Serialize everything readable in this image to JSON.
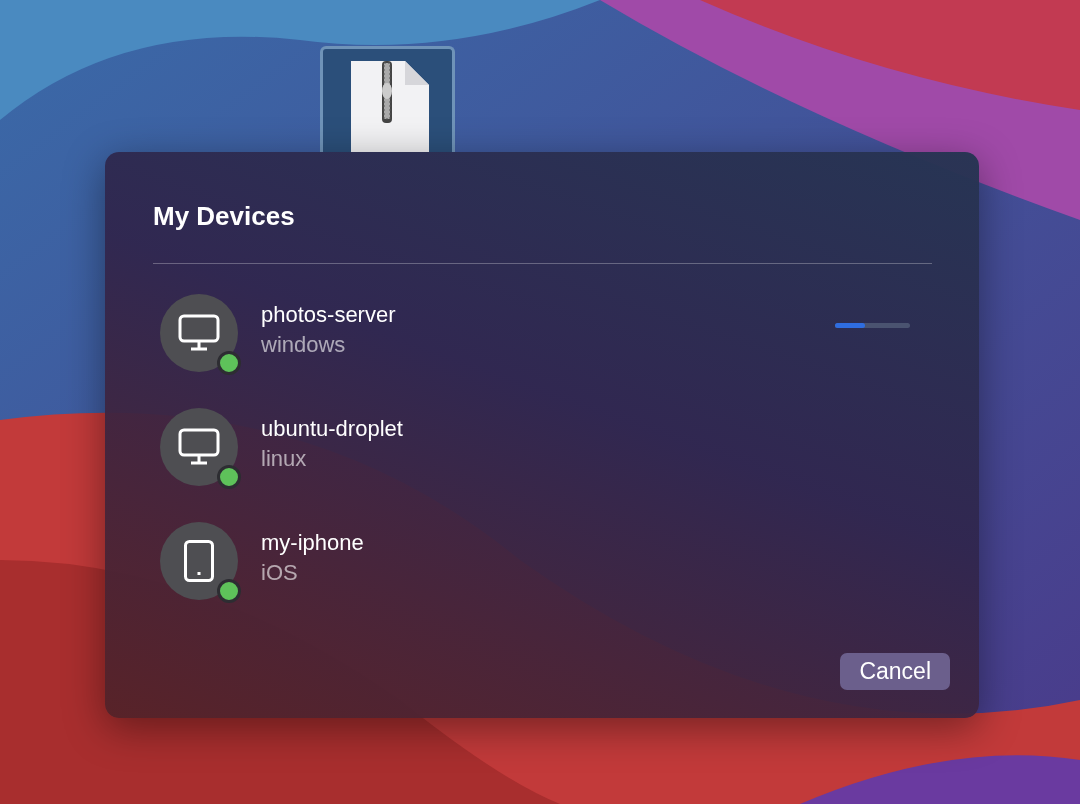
{
  "dialog": {
    "title": "My Devices",
    "devices": [
      {
        "name": "photos-server",
        "os": "windows",
        "kind": "computer",
        "online": true,
        "progress": {
          "level": 0.4
        }
      },
      {
        "name": "ubuntu-droplet",
        "os": "linux",
        "kind": "computer",
        "online": true
      },
      {
        "name": "my-iphone",
        "os": "iOS",
        "kind": "phone",
        "online": true
      }
    ],
    "buttons": [
      "Cancel"
    ]
  },
  "desktop": {
    "file_selected": true
  }
}
